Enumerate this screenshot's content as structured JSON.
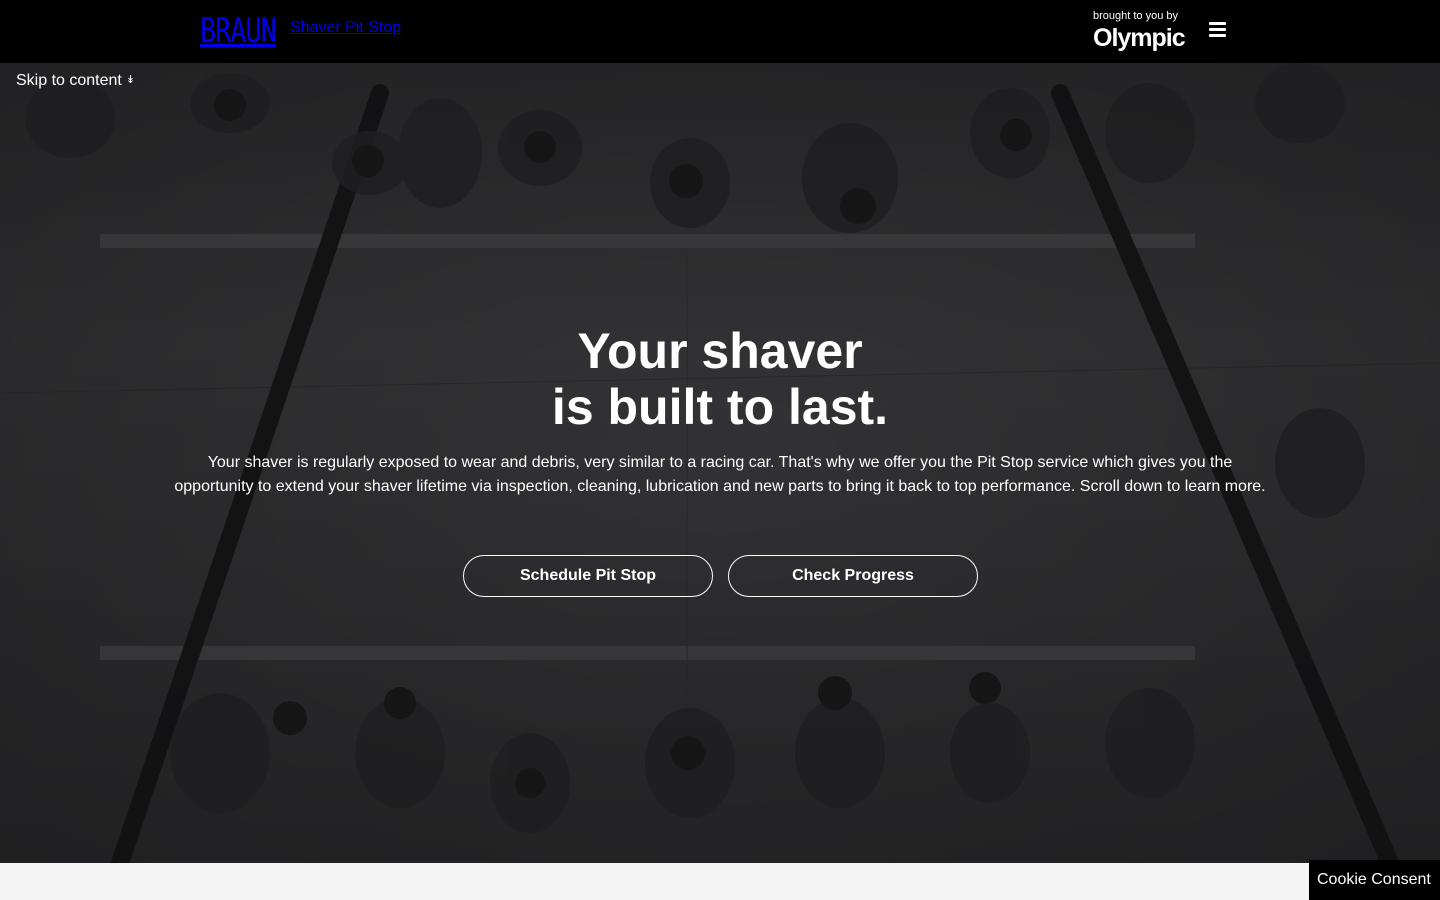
{
  "header": {
    "brand_logo": "BRAUN",
    "brand_subtitle": "Shaver Pit Stop",
    "partner_caption": "brought to you by",
    "partner_logo": "Olympic",
    "menu_icon": "hamburger-menu-icon"
  },
  "hero": {
    "skip_link": "Skip to content",
    "skip_icon": "double-chevron-down-icon",
    "title_line1": "Your shaver",
    "title_line2": "is built to last.",
    "description": "Your shaver is regularly exposed to wear and debris, very similar to a racing car. That's why we offer you the Pit Stop service which gives you the opportunity to extend your shaver lifetime via inspection, cleaning, lubrication and new parts to bring it back to top performance. Scroll down to learn more.",
    "buttons": [
      {
        "label": "Schedule Pit Stop"
      },
      {
        "label": "Check Progress"
      }
    ]
  },
  "footer": {
    "cookie_label": "Cookie Consent"
  },
  "colors": {
    "header_bg": "#000000",
    "hero_overlay": "#2f2f31",
    "text": "#ffffff",
    "bottom_strip": "#f4f4f4"
  }
}
